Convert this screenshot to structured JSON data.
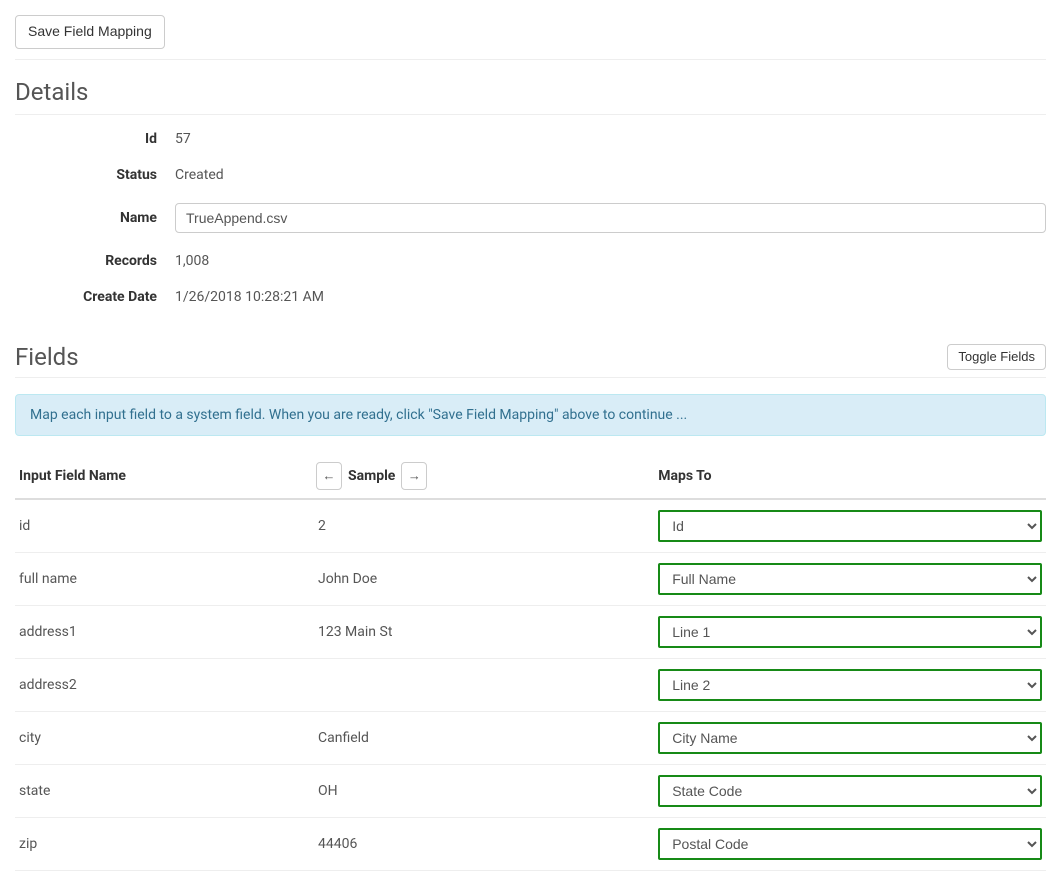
{
  "top": {
    "save_mapping": "Save Field Mapping"
  },
  "details": {
    "heading": "Details",
    "labels": {
      "id": "Id",
      "status": "Status",
      "name": "Name",
      "records": "Records",
      "create_date": "Create Date"
    },
    "values": {
      "id": "57",
      "status": "Created",
      "name": "TrueAppend.csv",
      "records": "1,008",
      "create_date": "1/26/2018 10:28:21 AM"
    }
  },
  "fields": {
    "heading": "Fields",
    "toggle_button": "Toggle Fields",
    "info_text": "Map each input field to a system field. When you are ready, click \"Save Field Mapping\" above to continue ...",
    "columns": {
      "input": "Input Field Name",
      "sample": "Sample",
      "mapsto": "Maps To"
    },
    "arrow_prev": "←",
    "arrow_next": "→",
    "rows": [
      {
        "input": "id",
        "sample": "2",
        "mapsto": "Id"
      },
      {
        "input": "full name",
        "sample": "John Doe",
        "mapsto": "Full Name"
      },
      {
        "input": "address1",
        "sample": "123 Main St",
        "mapsto": "Line 1"
      },
      {
        "input": "address2",
        "sample": "",
        "mapsto": "Line 2"
      },
      {
        "input": "city",
        "sample": "Canfield",
        "mapsto": "City Name"
      },
      {
        "input": "state",
        "sample": "OH",
        "mapsto": "State Code"
      },
      {
        "input": "zip",
        "sample": "44406",
        "mapsto": "Postal Code"
      }
    ]
  }
}
